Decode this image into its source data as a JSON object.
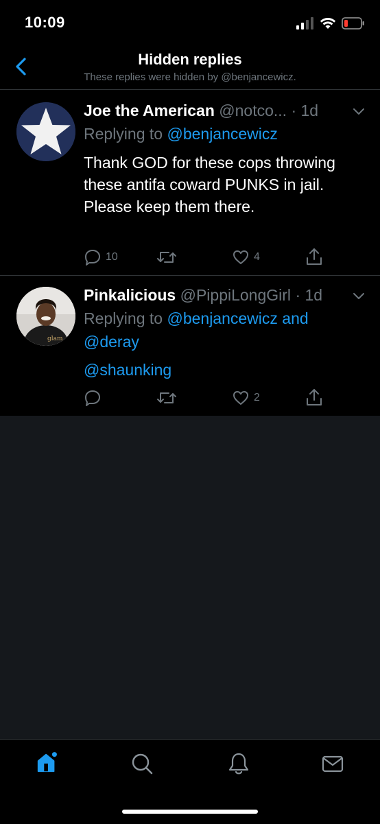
{
  "status_bar": {
    "time": "10:09"
  },
  "header": {
    "title": "Hidden replies",
    "subtitle": "These replies were hidden by @benjancewicz."
  },
  "tweets": [
    {
      "name": "Joe the American",
      "handle": "@notco...",
      "time": "· 1d",
      "replying_prefix": "Replying to ",
      "replying_to": "@benjancewicz",
      "text": "Thank GOD for these cops throwing these antifa coward PUNKS in jail.  Please keep them there.",
      "reply_count": "10",
      "retweet_count": "",
      "like_count": "4"
    },
    {
      "name": "Pinkalicious",
      "handle": "@PippiLongGirl",
      "time": "· 1d",
      "replying_prefix": "Replying to ",
      "replying_to": "@benjancewicz and",
      "replying_to_2": "@deray",
      "text": "@shaunking",
      "reply_count": "",
      "retweet_count": "",
      "like_count": "2"
    }
  ],
  "colors": {
    "accent": "#1d9bf0",
    "muted": "#6e767d",
    "background": "#000000"
  }
}
